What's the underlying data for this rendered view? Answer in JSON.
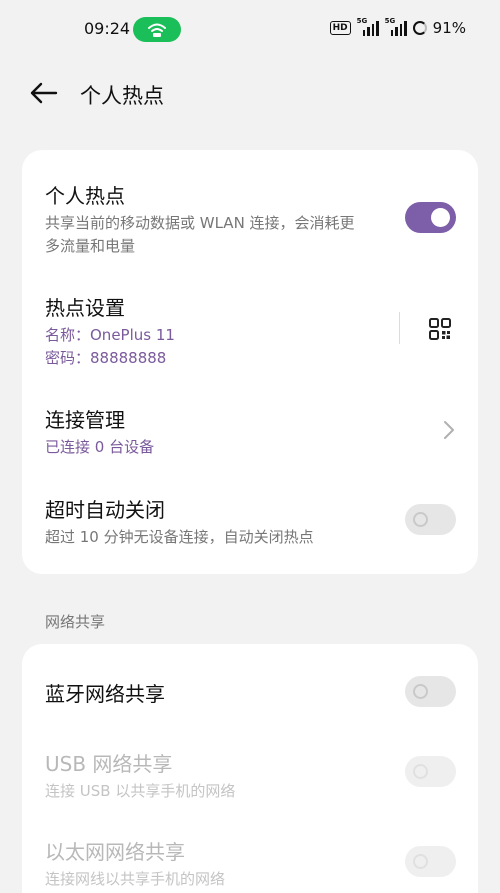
{
  "status_bar": {
    "time": "09:24",
    "hd_label": "HD",
    "signal1_tag": "5G",
    "signal2_tag": "5G",
    "battery": "91%",
    "hotspot_color": "#1bbf5a"
  },
  "header": {
    "title": "个人热点",
    "back_icon": "arrow-left-icon"
  },
  "hotspot": {
    "title": "个人热点",
    "description_line1": "共享当前的移动数据或 WLAN 连接，会消耗更",
    "description_line2": "多流量和电量",
    "enabled": true
  },
  "settings": {
    "title": "热点设置",
    "name_line": "名称：OnePlus 11",
    "password_line": "密码：88888888",
    "qr_icon": "qr-code-icon"
  },
  "connections": {
    "title": "连接管理",
    "subtitle": "已连接 0 台设备"
  },
  "auto_off": {
    "title": "超时自动关闭",
    "description": "超过 10 分钟无设备连接，自动关闭热点",
    "enabled": false
  },
  "network_sharing": {
    "section_label": "网络共享",
    "bluetooth": {
      "title": "蓝牙网络共享",
      "enabled": false
    },
    "usb": {
      "title": "USB 网络共享",
      "description": "连接 USB 以共享手机的网络",
      "enabled": false,
      "disabled": true
    },
    "ethernet": {
      "title": "以太网网络共享",
      "description": "连接网线以共享手机的网络",
      "enabled": false,
      "disabled": true
    }
  },
  "colors": {
    "accent": "#7d5ea8",
    "accent_text": "#7b5a9c",
    "background": "#f2f2f2"
  }
}
